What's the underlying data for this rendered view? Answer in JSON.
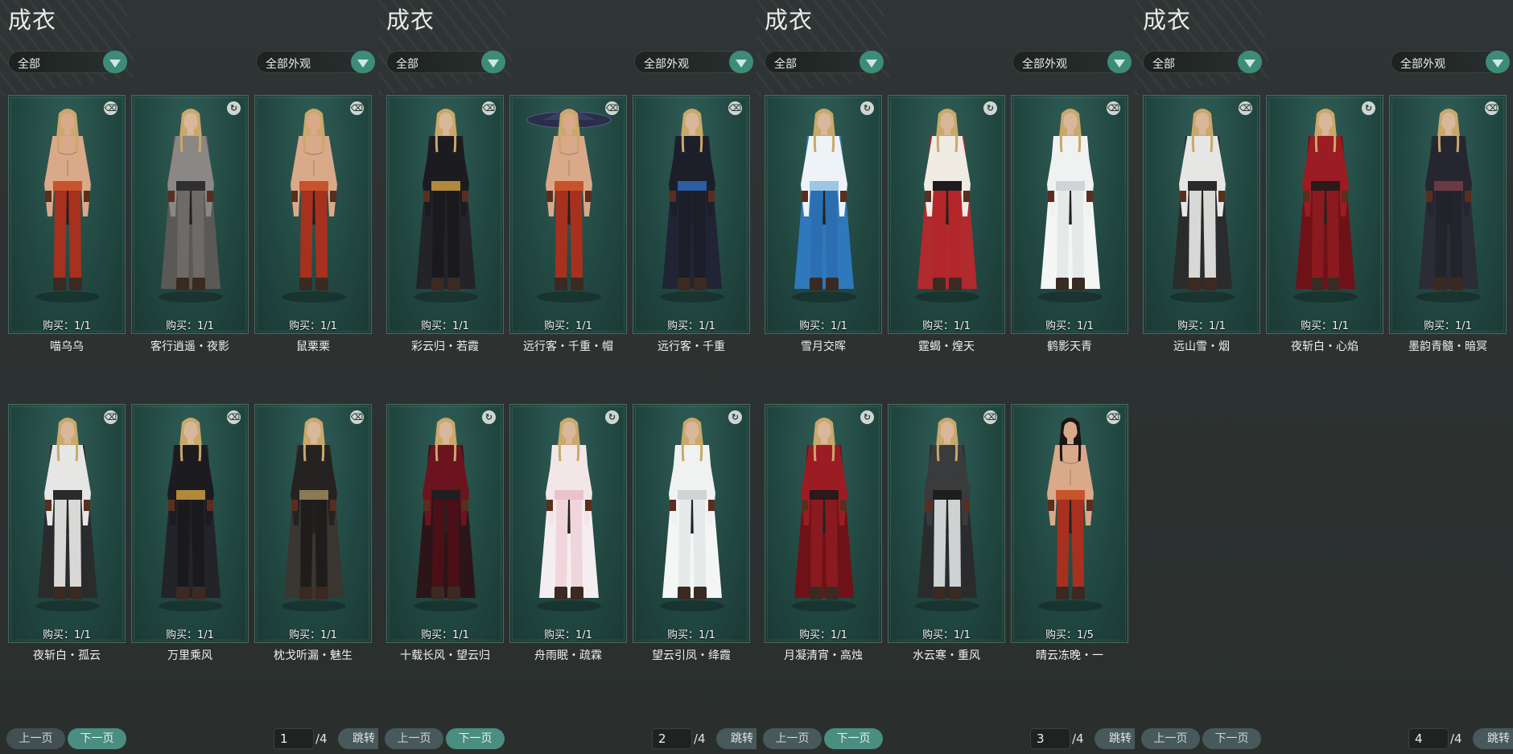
{
  "panels": [
    {
      "title": "成衣",
      "filter1": "全部",
      "filter2": "全部外观",
      "items": [
        {
          "name": "喵乌乌",
          "buy": "购买：1/1",
          "icon": "trash-icon",
          "style": "bare"
        },
        {
          "name": "客行逍遥・夜影",
          "buy": "购买：1/1",
          "icon": "refresh-icon",
          "style": "grey"
        },
        {
          "name": "鼠栗栗",
          "buy": "购买：1/1",
          "icon": "trash-icon",
          "style": "bare"
        },
        {
          "name": "夜斩白・孤云",
          "buy": "购买：1/1",
          "icon": "trash-icon",
          "style": "white-black"
        },
        {
          "name": "万里乘风",
          "buy": "购买：1/1",
          "icon": "trash-icon",
          "style": "black-gold"
        },
        {
          "name": "枕戈听漏・魅生",
          "buy": "购买：1/1",
          "icon": "trash-icon",
          "style": "black-fur"
        }
      ],
      "pager": {
        "prev": "上一页",
        "next": "下一页",
        "page": "1",
        "total": "/4",
        "jump": "跳转"
      }
    },
    {
      "title": "成衣",
      "filter1": "全部",
      "filter2": "全部外观",
      "items": [
        {
          "name": "彩云归・若霞",
          "buy": "购买：1/1",
          "icon": "trash-icon",
          "style": "black-gold"
        },
        {
          "name": "远行客・千重・帽",
          "buy": "购买：1/1",
          "icon": "trash-icon",
          "style": "bare-hat"
        },
        {
          "name": "远行客・千重",
          "buy": "购买：1/1",
          "icon": "trash-icon",
          "style": "black-blue"
        },
        {
          "name": "十载长风・望云归",
          "buy": "购买：1/1",
          "icon": "refresh-icon",
          "style": "red-black"
        },
        {
          "name": "舟雨眠・疏霖",
          "buy": "购买：1/1",
          "icon": "refresh-icon",
          "style": "pink-white"
        },
        {
          "name": "望云引凤・绛霞",
          "buy": "购买：1/1",
          "icon": "refresh-icon",
          "style": "white"
        }
      ],
      "pager": {
        "prev": "上一页",
        "next": "下一页",
        "page": "2",
        "total": "/4",
        "jump": "跳转"
      }
    },
    {
      "title": "成衣",
      "filter1": "全部",
      "filter2": "全部外观",
      "items": [
        {
          "name": "雪月交晖",
          "buy": "购买：1/1",
          "icon": "refresh-icon",
          "style": "blue-white"
        },
        {
          "name": "霆蝎・煌天",
          "buy": "购买：1/1",
          "icon": "refresh-icon",
          "style": "red-white"
        },
        {
          "name": "鹤影天青",
          "buy": "购买：1/1",
          "icon": "trash-icon",
          "style": "white"
        },
        {
          "name": "月凝清宵・高烛",
          "buy": "购买：1/1",
          "icon": "refresh-icon",
          "style": "red"
        },
        {
          "name": "水云寒・重风",
          "buy": "购买：1/1",
          "icon": "trash-icon",
          "style": "black-white"
        },
        {
          "name": "晴云冻晚・一",
          "buy": "购买：1/5",
          "icon": "trash-icon",
          "style": "bare-dark"
        }
      ],
      "pager": {
        "prev": "上一页",
        "next": "下一页",
        "page": "3",
        "total": "/4",
        "jump": "跳转"
      }
    },
    {
      "title": "成衣",
      "filter1": "全部",
      "filter2": "全部外观",
      "items": [
        {
          "name": "远山雪・烟",
          "buy": "购买：1/1",
          "icon": "trash-icon",
          "style": "white-black"
        },
        {
          "name": "夜斩白・心焰",
          "buy": "购买：1/1",
          "icon": "refresh-icon",
          "style": "red"
        },
        {
          "name": "墨韵青髓・暗冥",
          "buy": "购买：1/1",
          "icon": "trash-icon",
          "style": "dark"
        }
      ],
      "pager": {
        "prev": "上一页",
        "next": "下一页",
        "page": "4",
        "total": "/4",
        "jump": "跳转"
      }
    }
  ],
  "colors": {
    "accent": "#3c8c79",
    "background": "#2b302f",
    "card": "#234a43"
  }
}
